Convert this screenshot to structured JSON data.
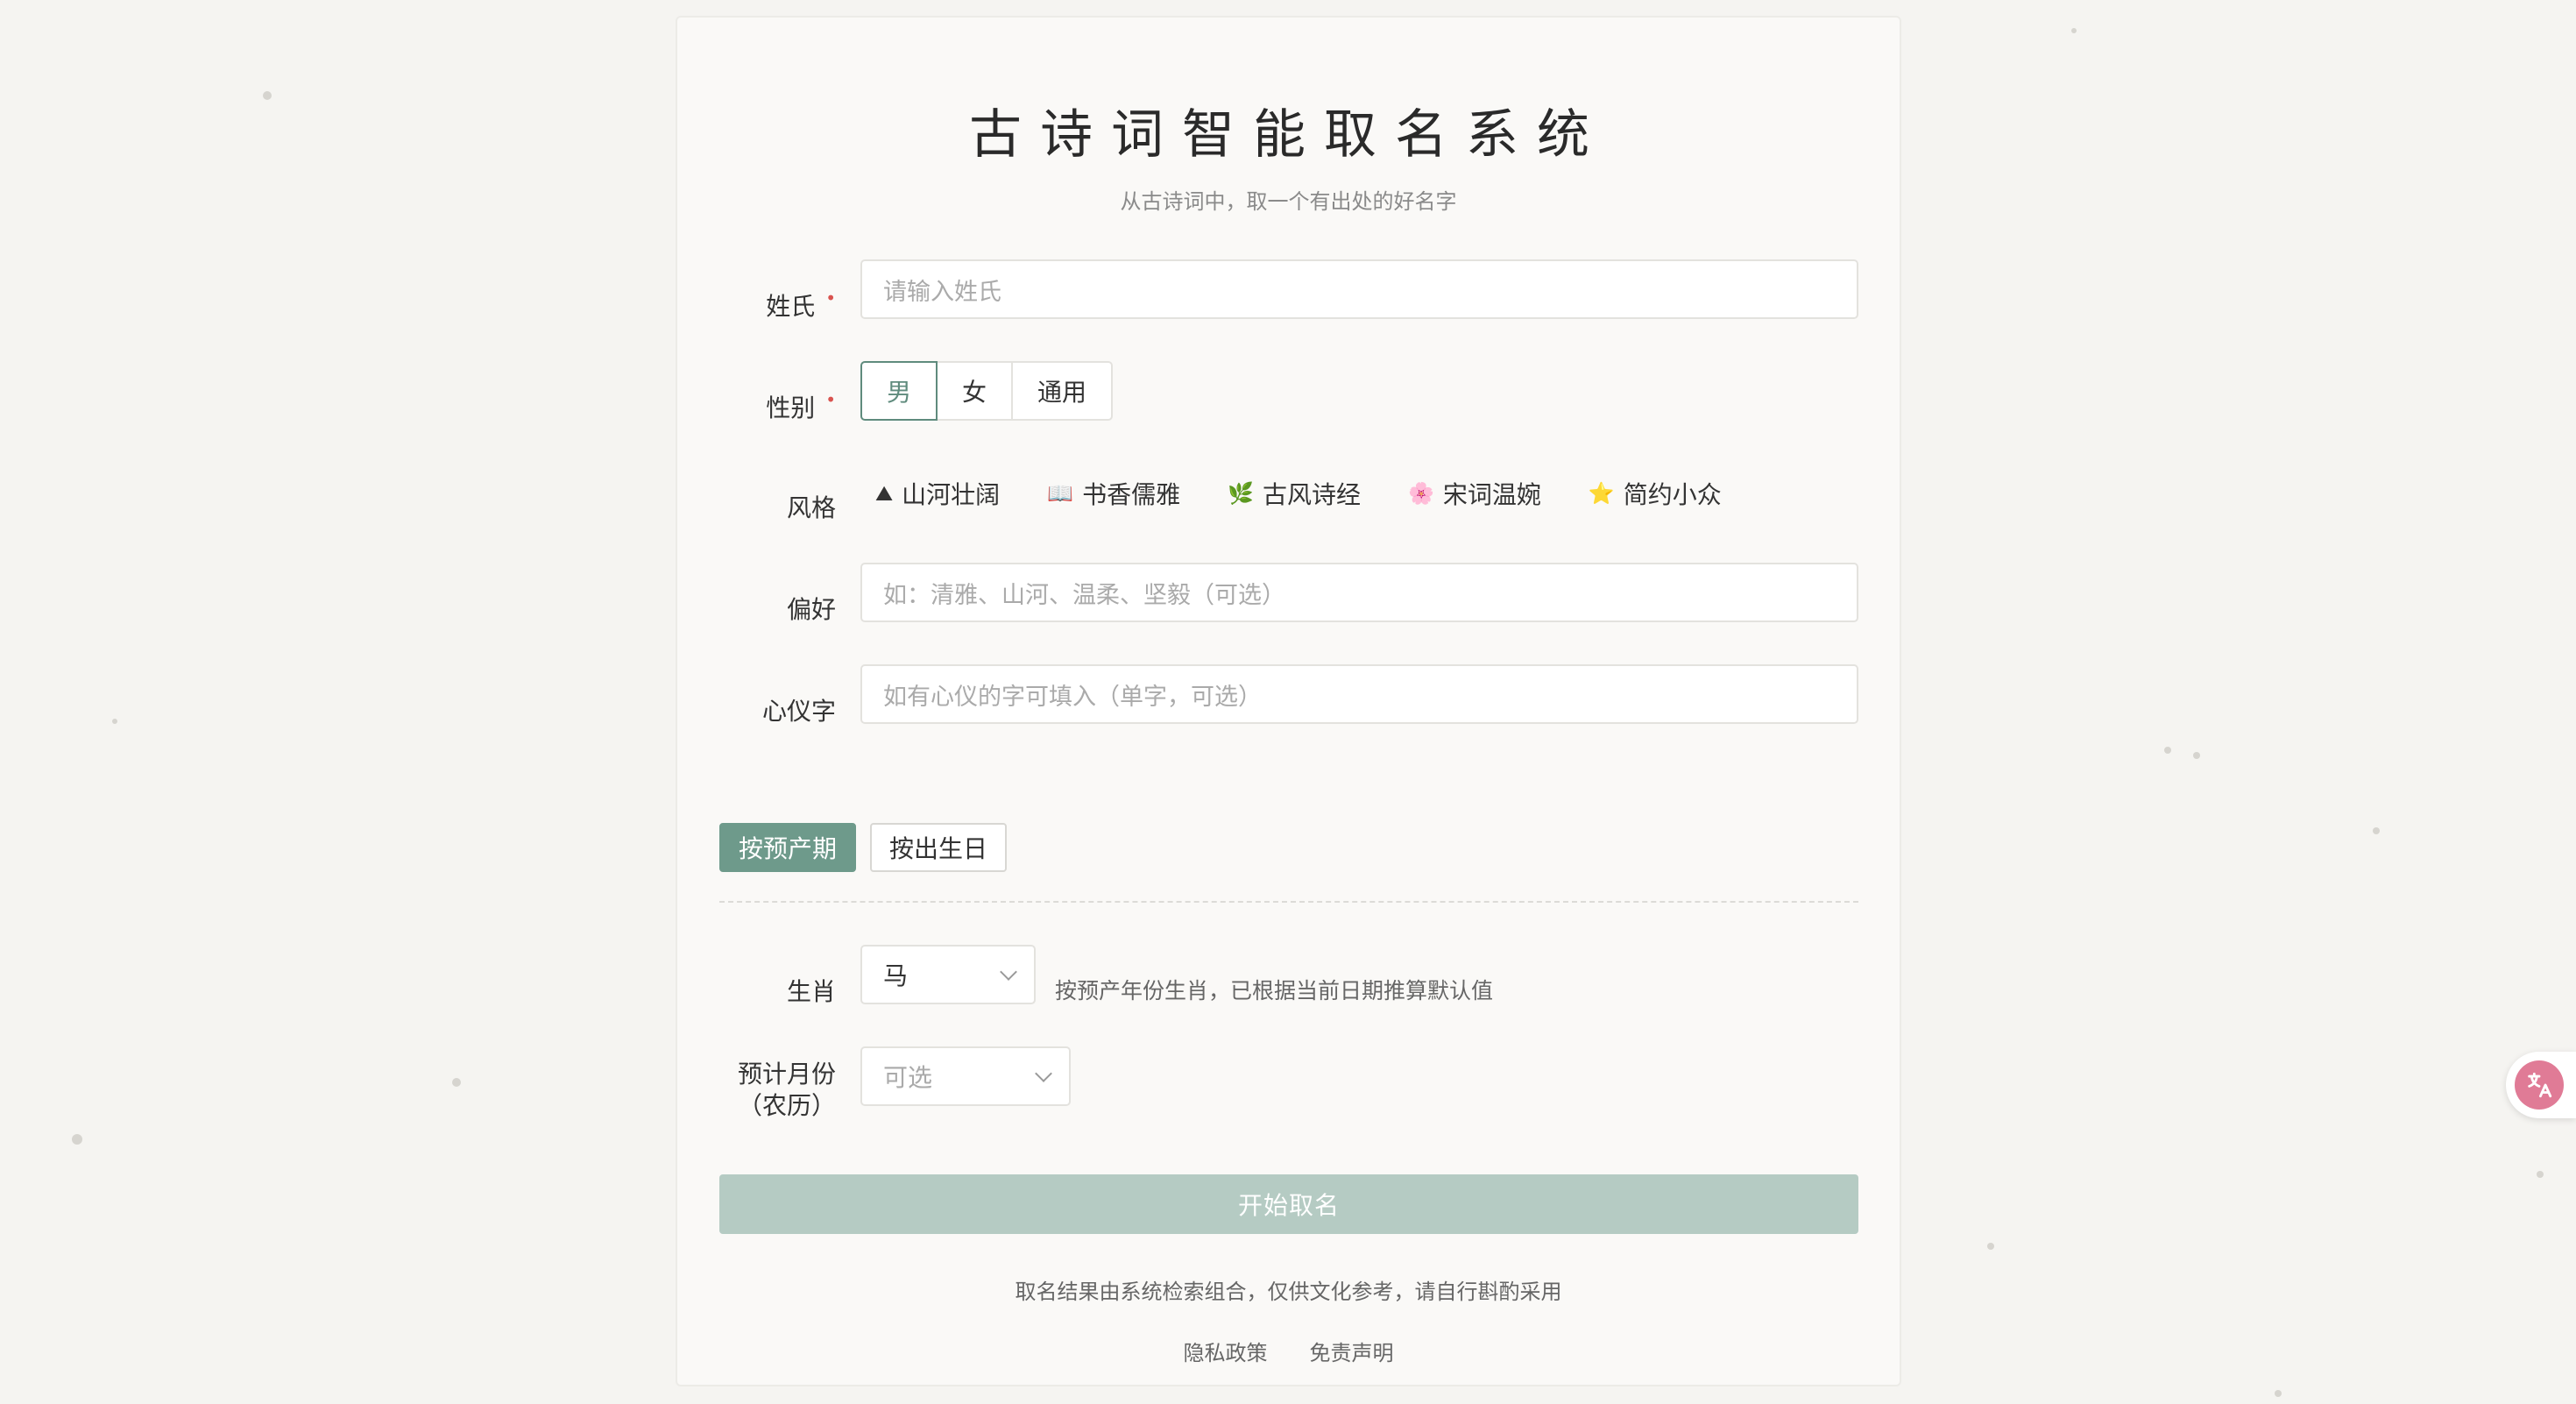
{
  "header": {
    "title": "古诗词智能取名系统",
    "subtitle": "从古诗词中，取一个有出处的好名字"
  },
  "form": {
    "surname": {
      "label": "姓氏",
      "placeholder": "请输入姓氏"
    },
    "gender": {
      "label": "性别",
      "options": [
        "男",
        "女",
        "通用"
      ],
      "selected": "男"
    },
    "style": {
      "label": "风格",
      "options": [
        {
          "icon": "mountain-icon",
          "glyph": "⛰",
          "text": "山河壮阔"
        },
        {
          "icon": "book-icon",
          "glyph": "📖",
          "text": "书香儒雅"
        },
        {
          "icon": "herb-icon",
          "glyph": "🌿",
          "text": "古风诗经"
        },
        {
          "icon": "blossom-icon",
          "glyph": "🌸",
          "text": "宋词温婉"
        },
        {
          "icon": "star-icon",
          "glyph": "⭐",
          "text": "简约小众"
        }
      ]
    },
    "preference": {
      "label": "偏好",
      "placeholder": "如：清雅、山河、温柔、坚毅（可选）"
    },
    "favorite_char": {
      "label": "心仪字",
      "placeholder": "如有心仪的字可填入（单字，可选）"
    },
    "mode_tabs": [
      "按预产期",
      "按出生日"
    ],
    "active_tab": "按预产期",
    "zodiac": {
      "label": "生肖",
      "value": "马",
      "hint": "按预产年份生肖，已根据当前日期推算默认值"
    },
    "month": {
      "label_line1": "预计月份",
      "label_line2": "（农历）",
      "placeholder": "可选"
    },
    "submit_label": "开始取名"
  },
  "footer": {
    "disclaimer": "取名结果由系统检索组合，仅供文化参考，请自行斟酌采用",
    "links": [
      "隐私政策",
      "免责声明"
    ]
  },
  "colors": {
    "accent": "#6e9a8b",
    "submit_disabled": "#b5cbc3",
    "required": "#d9534f",
    "translate_button": "#e07b96"
  }
}
